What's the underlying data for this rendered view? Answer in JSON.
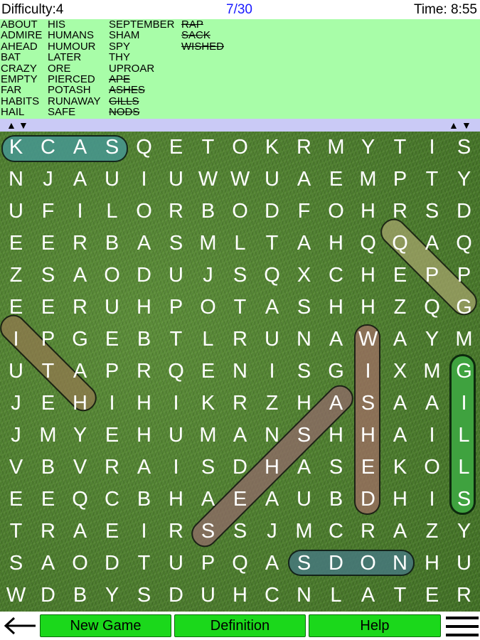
{
  "header": {
    "difficulty": "Difficulty:4",
    "progress": "7/30",
    "timer": "Time: 8:55"
  },
  "words": {
    "col1": [
      {
        "text": "ABOUT",
        "found": false
      },
      {
        "text": "ADMIRE",
        "found": false
      },
      {
        "text": "AHEAD",
        "found": false
      },
      {
        "text": "BAT",
        "found": false
      },
      {
        "text": "CRAZY",
        "found": false
      },
      {
        "text": "EMPTY",
        "found": false
      },
      {
        "text": "FAR",
        "found": false
      },
      {
        "text": "HABITS",
        "found": false
      },
      {
        "text": "HAIL",
        "found": false
      }
    ],
    "col2": [
      {
        "text": "HIS",
        "found": false
      },
      {
        "text": "HUMANS",
        "found": false
      },
      {
        "text": "HUMOUR",
        "found": false
      },
      {
        "text": "LATER",
        "found": false
      },
      {
        "text": "ORE",
        "found": false
      },
      {
        "text": "PIERCED",
        "found": false
      },
      {
        "text": "POTASH",
        "found": false
      },
      {
        "text": "RUNAWAY",
        "found": false
      },
      {
        "text": "SAFE",
        "found": false
      }
    ],
    "col3": [
      {
        "text": "SEPTEMBER",
        "found": false
      },
      {
        "text": "SHAM",
        "found": false
      },
      {
        "text": "SPY",
        "found": false
      },
      {
        "text": "THY",
        "found": false
      },
      {
        "text": "UPROAR",
        "found": false
      },
      {
        "text": "APE",
        "found": true
      },
      {
        "text": "ASHES",
        "found": true
      },
      {
        "text": "GILLS",
        "found": true
      },
      {
        "text": "NODS",
        "found": true
      }
    ],
    "col4": [
      {
        "text": "RAP",
        "found": true
      },
      {
        "text": "SACK",
        "found": true
      },
      {
        "text": "WISHED",
        "found": true
      }
    ]
  },
  "scroll_arrows": {
    "left": [
      "▲",
      "▼"
    ],
    "right": [
      "▲",
      "▼"
    ]
  },
  "grid": {
    "rows": [
      "KCASQETOKRMYTIS",
      "NJAUIUWWUAEMPTY",
      "UFILORBODFOHRSD",
      "EERBASMLTAHQQAQ",
      "ZSAODUJSQXCHEPP",
      "EERUHPOTASHHZQG",
      "IPGEBTLRUNAWAYM",
      "UTAPRQENISGIXMG",
      "JEHIHIKRZHASAAI",
      "JMYEHUMANSHHAIL",
      "VBVRAISDHASEKOL",
      "EEQCBHAEAUBDHIS",
      "TRAEIRSSJMCRAZY",
      "SAODTUPQASDONHU",
      "WDBYSDUHCNLATER"
    ]
  },
  "found_colors": {
    "sack": "#3f8d87",
    "rap": "#9a9a6a",
    "ape": "#8f7a55",
    "wished": "#94706a",
    "ashes": "#8a6d6d",
    "nods": "#3f7378",
    "gills": "#3fa23f"
  },
  "buttons": {
    "new_game": "New Game",
    "definition": "Definition",
    "help": "Help"
  },
  "icons": {
    "back": "left-arrow-icon",
    "menu": "hamburger-menu-icon"
  }
}
